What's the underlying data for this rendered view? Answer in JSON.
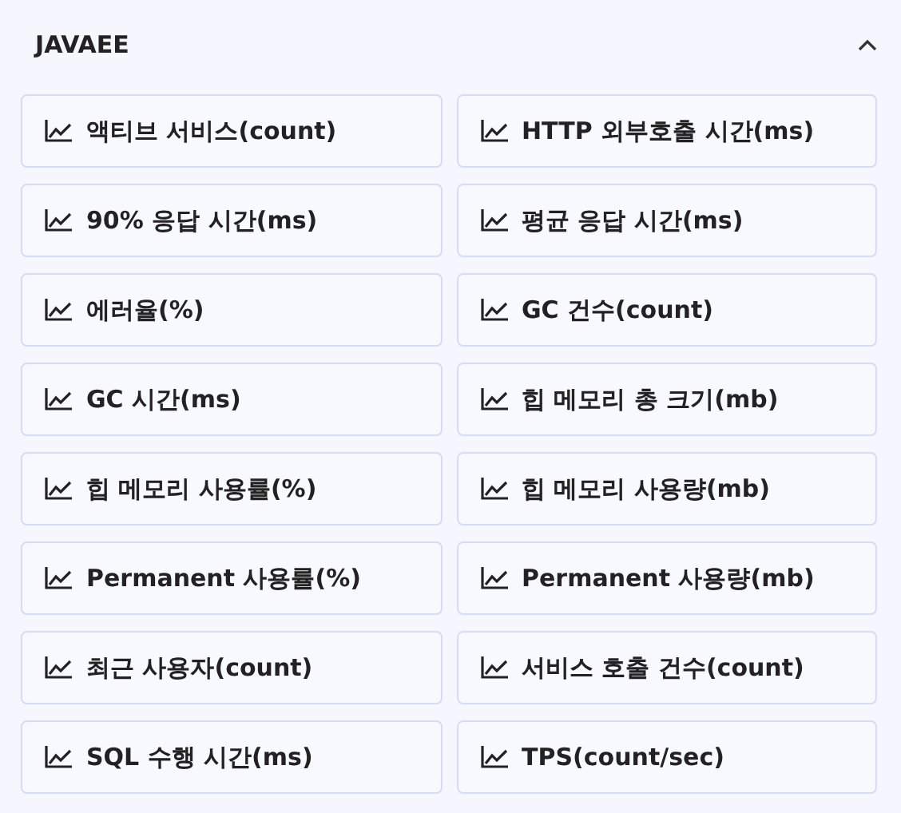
{
  "section": {
    "title": "JAVAEE",
    "expanded": true
  },
  "items": [
    {
      "label": "액티브 서비스(count)"
    },
    {
      "label": "HTTP 외부호출 시간(ms)"
    },
    {
      "label": "90% 응답 시간(ms)"
    },
    {
      "label": "평균 응답 시간(ms)"
    },
    {
      "label": "에러율(%)"
    },
    {
      "label": "GC 건수(count)"
    },
    {
      "label": "GC 시간(ms)"
    },
    {
      "label": "힙 메모리 총 크기(mb)"
    },
    {
      "label": "힙 메모리 사용률(%)"
    },
    {
      "label": "힙 메모리 사용량(mb)"
    },
    {
      "label": "Permanent 사용률(%)"
    },
    {
      "label": "Permanent 사용량(mb)"
    },
    {
      "label": "최근 사용자(count)"
    },
    {
      "label": "서비스 호출 건수(count)"
    },
    {
      "label": "SQL 수행 시간(ms)"
    },
    {
      "label": "TPS(count/sec)"
    }
  ]
}
